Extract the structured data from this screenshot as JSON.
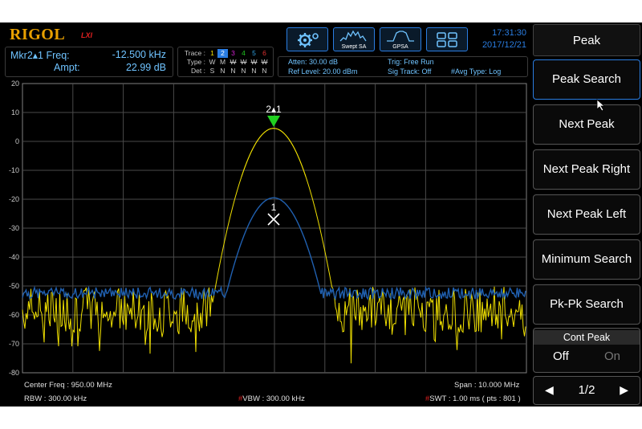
{
  "header": {
    "logo": "RIGOL",
    "logo_suffix": "LXI",
    "marker": {
      "freq_label": "Mkr2▴1 Freq:",
      "freq_value": "-12.500 kHz",
      "ampt_label": "Ampt:",
      "ampt_value": "22.99 dB"
    },
    "trace": {
      "row1_label": "Trace :",
      "row1": [
        "1",
        "2",
        "3",
        "4",
        "5",
        "6"
      ],
      "row1_colors": [
        "#f0e000",
        "#2a7de1",
        "#d020d0",
        "#20c020",
        "#30a0e0",
        "#e03030"
      ],
      "row2_label": "Type :",
      "row2": [
        "W",
        "M",
        "W",
        "W",
        "W",
        "W"
      ],
      "row3_label": "Det :",
      "row3": [
        "S",
        "N",
        "N",
        "N",
        "N",
        "N"
      ]
    },
    "info": {
      "atten": "Atten: 30.00 dB",
      "ref_level": "Ref Level: 20.00 dBm",
      "trig": "Trig: Free Run",
      "sig_track": "Sig Track: Off",
      "avg_type": "#Avg Type: Log"
    },
    "modes": {
      "settings_icon": "settings-gear-icon",
      "swept_sa": "Swept SA",
      "gpsa": "GPSA",
      "layout_icon": "layout-grid-icon"
    },
    "time": "17:31:30",
    "date": "2017/12/21"
  },
  "plot": {
    "y_ticks": [
      "20",
      "10",
      "0",
      "-10",
      "-20",
      "-30",
      "-40",
      "-50",
      "-60",
      "-70",
      "-80"
    ],
    "marker_ref_label": "2▴1",
    "marker_delta_label": "1",
    "center_freq": "Center Freq : 950.00 MHz",
    "rbw": "RBW : 300.00 kHz",
    "vbw": "VBW : 300.00 kHz",
    "vbw_flag": "#",
    "span": "Span : 10.000 MHz",
    "swt": "SWT : 1.00 ms ( pts : 801 )",
    "swt_flag": "#",
    "trace_colors": {
      "trace1": "#f0e000",
      "trace2": "#2060b0"
    }
  },
  "softkeys": {
    "title": "Peak",
    "items": [
      "Peak Search",
      "Next Peak",
      "Next Peak Right",
      "Next Peak Left",
      "Minimum Search",
      "Pk-Pk Search"
    ],
    "cont_peak": {
      "title": "Cont Peak",
      "off": "Off",
      "on": "On"
    },
    "page": "1/2"
  }
}
